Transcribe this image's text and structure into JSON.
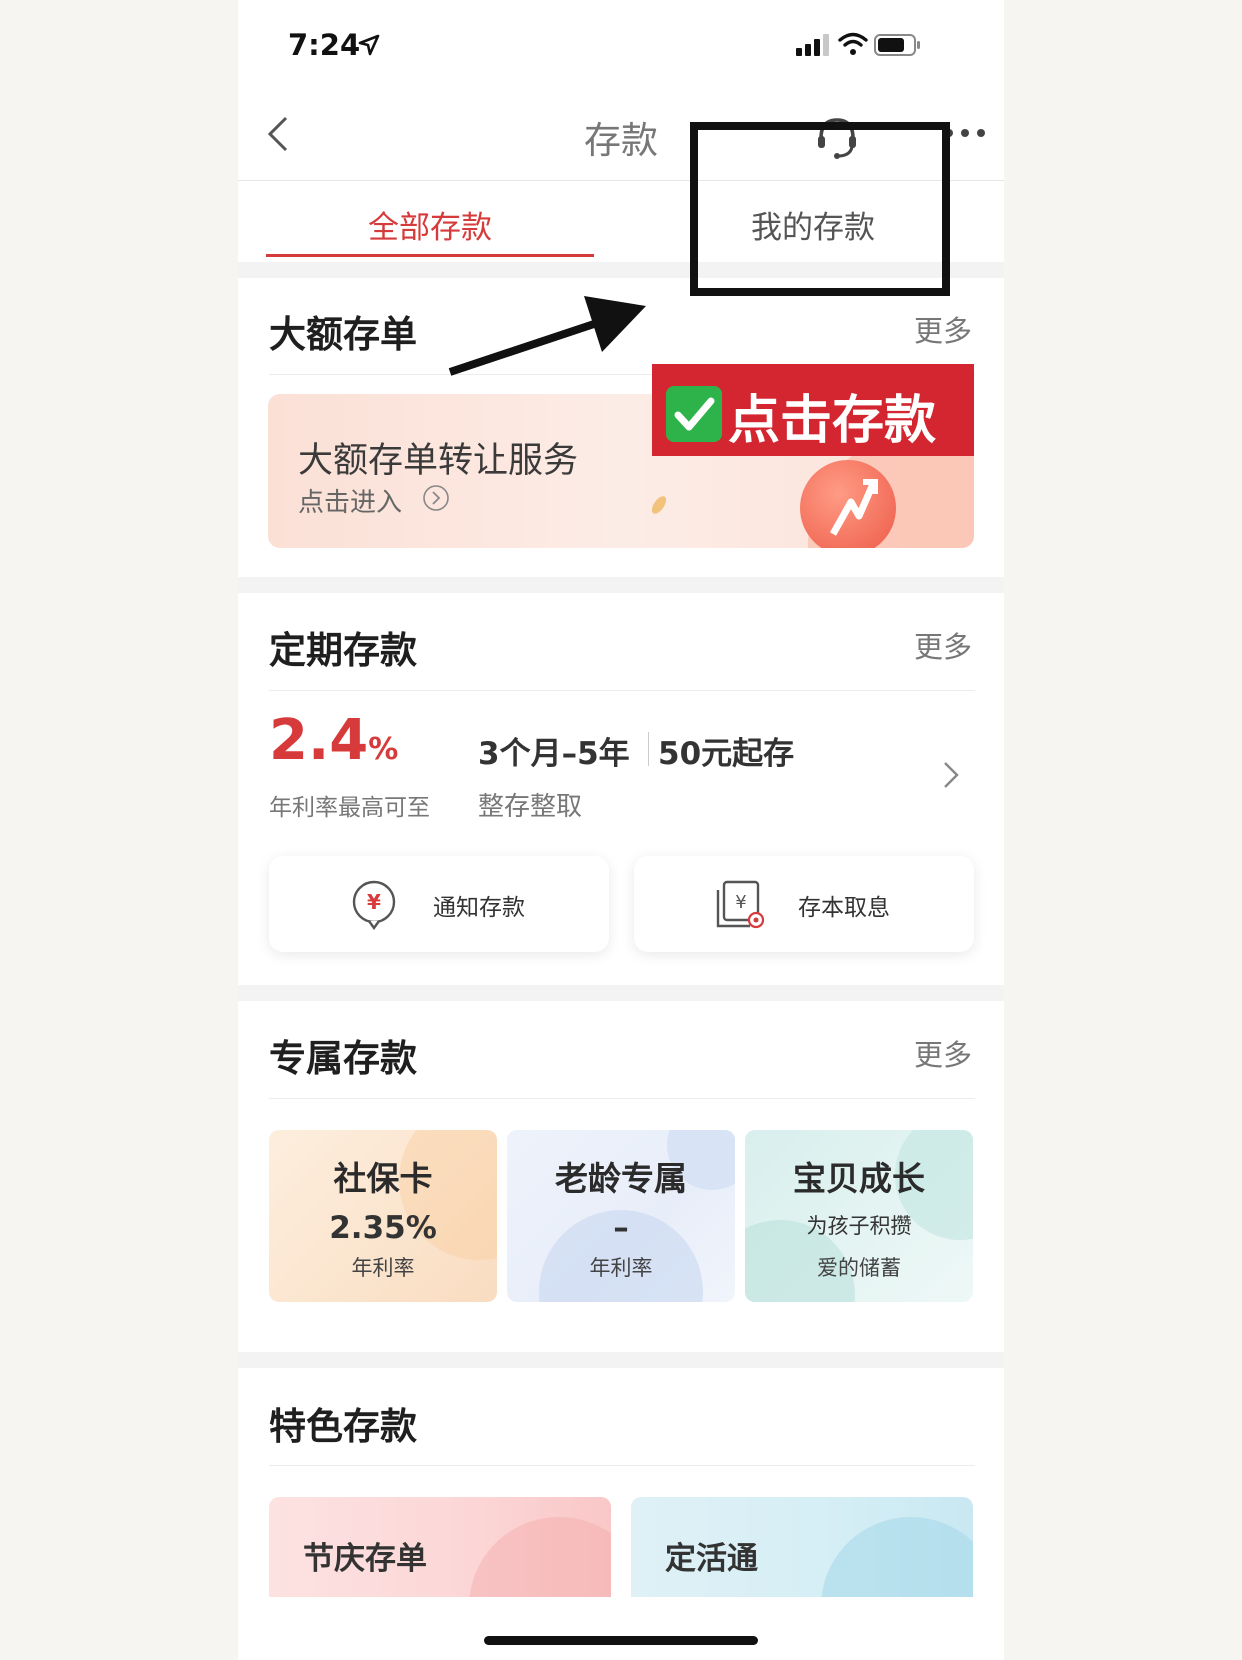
{
  "status_bar": {
    "time": "7:24"
  },
  "nav": {
    "title": "存款"
  },
  "tabs": [
    {
      "label": "全部存款",
      "active": true
    },
    {
      "label": "我的存款",
      "active": false
    }
  ],
  "annotation": {
    "label": "点击存款"
  },
  "large_cd": {
    "title": "大额存单",
    "more": "更多",
    "banner_title": "大额存单转让服务",
    "banner_sub": "点击进入"
  },
  "fixed": {
    "title": "定期存款",
    "more": "更多",
    "rate_num": "2.4",
    "rate_unit": "%",
    "rate_caption": "年利率最高可至",
    "term": "3个月–5年",
    "min": "50元起存",
    "type": "整存整取",
    "buttons": [
      {
        "label": "通知存款"
      },
      {
        "label": "存本取息"
      }
    ]
  },
  "exclusive": {
    "title": "专属存款",
    "more": "更多",
    "cards": [
      {
        "title": "社保卡",
        "value": "2.35%",
        "caption": "年利率"
      },
      {
        "title": "老龄专属",
        "value": "–",
        "caption": "年利率"
      },
      {
        "title": "宝贝成长",
        "line1": "为孩子积攒",
        "line2": "爱的储蓄"
      }
    ]
  },
  "featured": {
    "title": "特色存款",
    "cards": [
      {
        "label": "节庆存单"
      },
      {
        "label": "定活通"
      }
    ]
  },
  "colors": {
    "accent": "#d63a3a",
    "annotation_bg": "#d42630",
    "check_green": "#2db34a"
  }
}
